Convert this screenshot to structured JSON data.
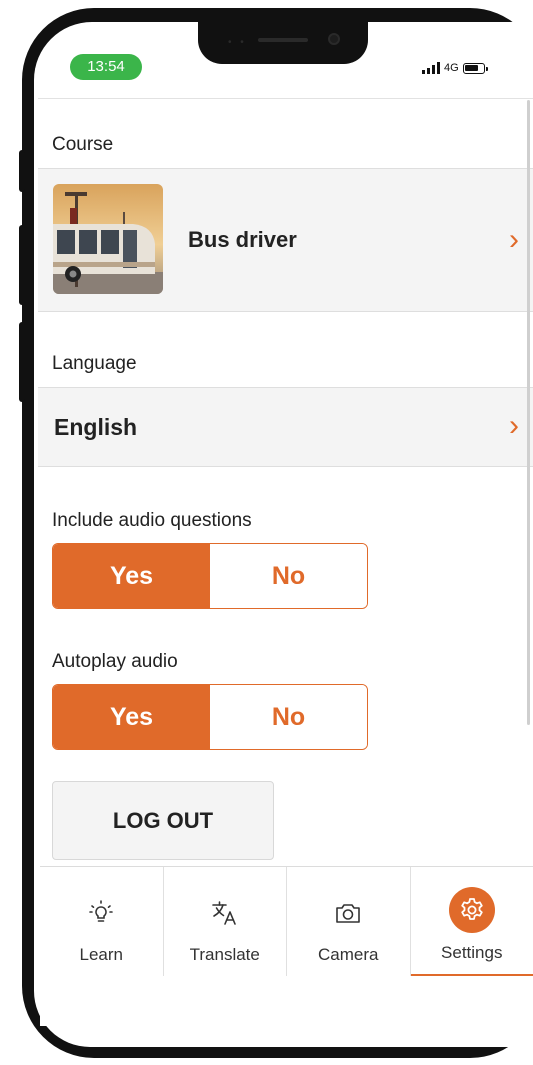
{
  "status_bar": {
    "time": "13:54",
    "network": "4G"
  },
  "settings": {
    "course_label": "Course",
    "course_name": "Bus driver",
    "language_label": "Language",
    "language_name": "English",
    "audio_questions": {
      "label": "Include audio questions",
      "yes": "Yes",
      "no": "No",
      "selected": "Yes"
    },
    "autoplay_audio": {
      "label": "Autoplay audio",
      "yes": "Yes",
      "no": "No",
      "selected": "Yes"
    },
    "logout_label": "LOG OUT"
  },
  "tabbar": {
    "tabs": [
      {
        "label": "Learn",
        "icon": "lightbulb-icon"
      },
      {
        "label": "Translate",
        "icon": "translate-icon"
      },
      {
        "label": "Camera",
        "icon": "camera-icon"
      },
      {
        "label": "Settings",
        "icon": "gear-icon",
        "active": true
      }
    ]
  },
  "colors": {
    "accent": "#e06a2a",
    "status_green": "#3bb54a"
  }
}
